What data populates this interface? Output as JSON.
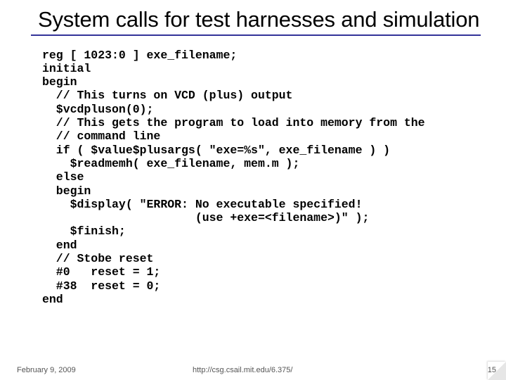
{
  "title": "System calls for test harnesses and simulation",
  "code": "reg [ 1023:0 ] exe_filename;\ninitial\nbegin\n  // This turns on VCD (plus) output\n  $vcdpluson(0);\n  // This gets the program to load into memory from the\n  // command line\n  if ( $value$plusargs( \"exe=%s\", exe_filename ) )\n    $readmemh( exe_filename, mem.m );\n  else\n  begin\n    $display( \"ERROR: No executable specified!\n                      (use +exe=<filename>)\" );\n    $finish;\n  end\n  // Stobe reset\n  #0   reset = 1;\n  #38  reset = 0;\nend",
  "footer": {
    "date": "February 9, 2009",
    "url": "http://csg.csail.mit.edu/6.375/",
    "page": "15"
  }
}
